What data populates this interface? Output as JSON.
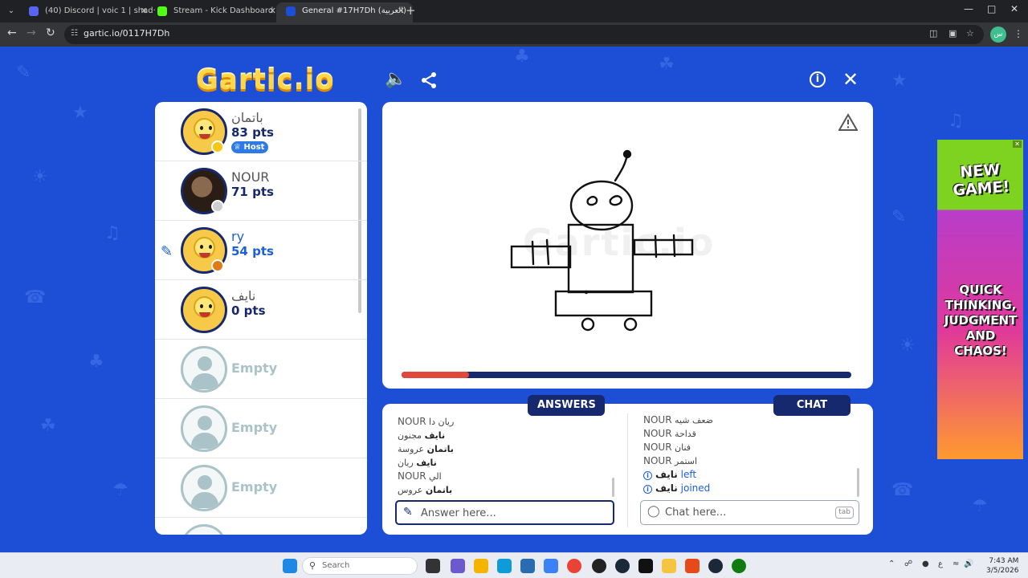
{
  "browser": {
    "tabs": [
      {
        "title": "(40) Discord | voic 1 | shad·",
        "favicon_color": "#5865f2"
      },
      {
        "title": "Stream - Kick Dashboard",
        "favicon_color": "#53fc18"
      },
      {
        "title": "General #17H7Dh (العربية) - Ga",
        "favicon_color": "#1d4fd6"
      }
    ],
    "url": "gartic.io/0117H7Dh",
    "profile_initial": "س"
  },
  "game": {
    "logo": "Gartic.io",
    "players": [
      {
        "name": "باتمان",
        "pts": "83 pts",
        "host_label": "Host",
        "status_color": "#f5c518",
        "avatar": "smiley"
      },
      {
        "name": "NOUR",
        "pts": "71 pts",
        "status_color": "#cfcfcf",
        "avatar": "photo"
      },
      {
        "name": "ry",
        "pts": "54 pts",
        "status_color": "#e07b18",
        "avatar": "smiley",
        "drawing": true
      },
      {
        "name": "نايف",
        "pts": "0 pts",
        "avatar": "smiley"
      },
      {
        "name": "Empty"
      },
      {
        "name": "Empty"
      },
      {
        "name": "Empty"
      }
    ],
    "timer_progress": 0.15,
    "answers_label": "ANSWERS",
    "chat_label": "CHAT",
    "answers": [
      {
        "name": "NOUR",
        "text": "ريان دا"
      },
      {
        "name": "نايف",
        "text": "مجنون"
      },
      {
        "name": "باتمان",
        "text": "عروسة"
      },
      {
        "name": "نايف",
        "text": "ريان"
      },
      {
        "name": "NOUR",
        "text": "الي"
      },
      {
        "name": "باتمان",
        "text": "عروس"
      }
    ],
    "chat": [
      {
        "name": "NOUR",
        "text": "ضعف شيه"
      },
      {
        "name": "NOUR",
        "text": "قداحة"
      },
      {
        "name": "NOUR",
        "text": "فنان"
      },
      {
        "name": "NOUR",
        "text": "استمر"
      }
    ],
    "system_msgs": [
      {
        "name": "نايف",
        "text": "left"
      },
      {
        "name": "نايف",
        "text": "joined"
      }
    ],
    "answer_placeholder": "Answer here...",
    "chat_placeholder": "Chat here...",
    "tab_key": "tab"
  },
  "ad": {
    "headline": "NEW GAME!",
    "tagline": "QUICK THINKING, JUDGMENT AND CHAOS!"
  },
  "taskbar": {
    "search_label": "Search",
    "time": "7:43 AM",
    "date": "3/5/2026"
  }
}
